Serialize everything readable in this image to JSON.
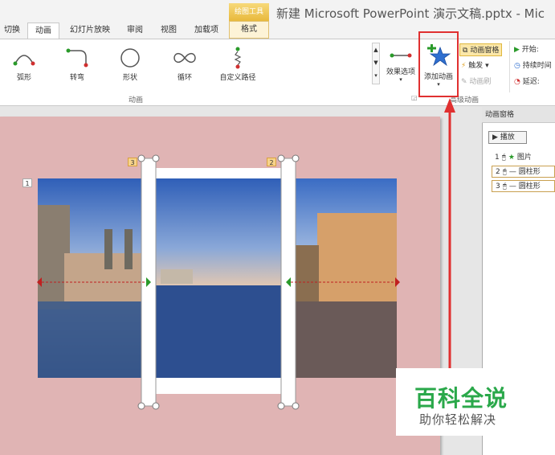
{
  "window": {
    "title": "新建 Microsoft PowerPoint 演示文稿.pptx - Mic"
  },
  "tabs": [
    {
      "label": "切换"
    },
    {
      "label": "动画"
    },
    {
      "label": "幻灯片放映"
    },
    {
      "label": "审阅"
    },
    {
      "label": "视图"
    },
    {
      "label": "加载项"
    }
  ],
  "tool_tab": {
    "header": "绘图工具",
    "label": "格式"
  },
  "ribbon": {
    "gallery": [
      {
        "label": "弧形"
      },
      {
        "label": "转弯"
      },
      {
        "label": "形状"
      },
      {
        "label": "循环"
      },
      {
        "label": "自定义路径"
      }
    ],
    "effect_options": "效果选项",
    "add_animation": "添加动画",
    "anim_pane_btn": "动画窗格",
    "trigger": "触发",
    "anim_painter": "动画刷",
    "start_label": "开始:",
    "duration_label": "持续时间",
    "delay_label": "延迟:",
    "group_animation": "动画",
    "group_advanced": "高级动画"
  },
  "slide": {
    "badges": [
      "1",
      "3",
      "2"
    ]
  },
  "anim_pane": {
    "title": "动画窗格",
    "play": "播放",
    "items": [
      {
        "num": "1",
        "text": "图片"
      },
      {
        "num": "2",
        "text": "— 圆柱形"
      },
      {
        "num": "3",
        "text": "— 圆柱形"
      }
    ]
  },
  "watermark": {
    "title": "百科全说",
    "subtitle": "助你轻松解决"
  },
  "colors": {
    "slide_bg": "#e0b4b4",
    "highlight": "#e03030",
    "watermark_green": "#2aa84a"
  }
}
